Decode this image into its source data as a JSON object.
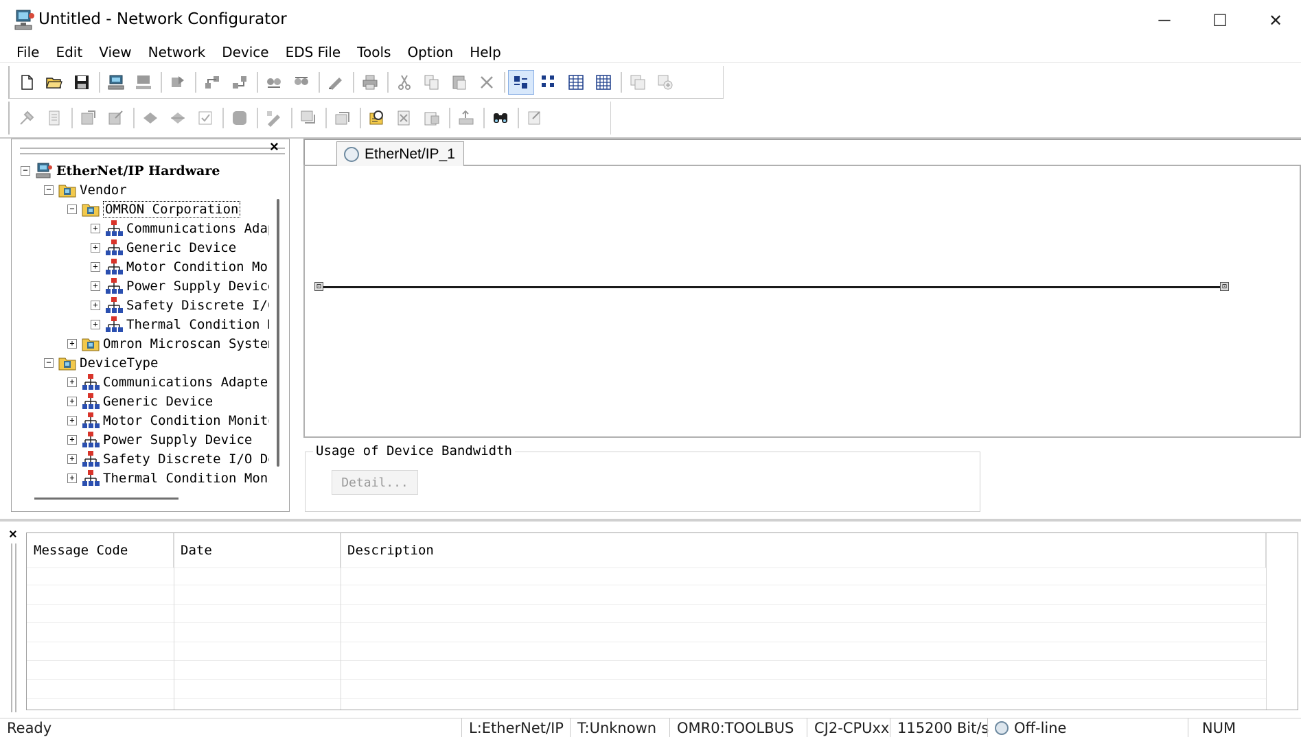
{
  "window": {
    "title": "Untitled - Network Configurator",
    "minimize": "─",
    "maximize": "☐",
    "close": "✕"
  },
  "menu": [
    "File",
    "Edit",
    "View",
    "Network",
    "Device",
    "EDS File",
    "Tools",
    "Option",
    "Help"
  ],
  "toolbar1": {
    "buttons": [
      "new-icon",
      "open-icon",
      "save-icon",
      "connect-icon",
      "disconnect-icon",
      "upload-icon",
      "wizard-icon",
      "parameter-icon",
      "download-icon",
      "upload-all-icon",
      "print-preview-icon",
      "print-icon",
      "cut-icon",
      "copy-icon",
      "paste-icon",
      "delete-icon",
      "large-icon-view-icon",
      "small-icon-view-icon",
      "list-view-icon",
      "detail-view-icon",
      "zoom-in-icon",
      "zoom-out-icon"
    ]
  },
  "toolbar2": {
    "buttons": [
      "properties-icon",
      "monitor-icon",
      "register-icon",
      "deregister-icon",
      "expand-icon",
      "collapse-icon",
      "validate-icon",
      "stop-icon",
      "edit-device-icon",
      "install-eds-icon",
      "create-eds-icon",
      "find-device-icon",
      "delete-eds-icon",
      "save-eds-icon",
      "export-icon",
      "find-icon",
      "settings-icon"
    ]
  },
  "hardware_tree": {
    "root": "EtherNet/IP Hardware",
    "vendor_label": "Vendor",
    "omron_label": "OMRON Corporation",
    "omron_children": [
      "Communications Adap",
      "Generic Device",
      "Motor Condition Mor",
      "Power Supply Device",
      "Safety Discrete I/C",
      "Thermal Condition M"
    ],
    "microscan_label": "Omron Microscan System",
    "devicetype_label": "DeviceType",
    "devicetype_children": [
      "Communications Adapter",
      "Generic Device",
      "Motor Condition Monito",
      "Power Supply Device",
      "Safety Discrete I/O De",
      "Thermal Condition Moni"
    ],
    "panel_close": "×"
  },
  "network_tab": {
    "label": "EtherNet/IP_1"
  },
  "bandwidth": {
    "legend": "Usage of Device Bandwidth",
    "detail_button": "Detail..."
  },
  "messages": {
    "close": "×",
    "columns": [
      "Message Code",
      "Date",
      "Description"
    ],
    "rows": []
  },
  "status": {
    "ready": "Ready",
    "network": "L:EtherNet/IP",
    "target": "T:Unknown",
    "port": "OMR0:TOOLBUS",
    "cpu": "CJ2-CPUxx",
    "baud": "115200 Bit/s",
    "mode": "Off-line",
    "num": "NUM"
  },
  "colors": {
    "accent": "#88aee4",
    "border": "#a0a0a0",
    "disabled_text": "#9a9a9a"
  }
}
